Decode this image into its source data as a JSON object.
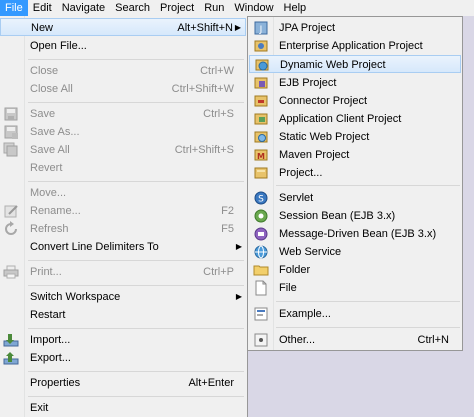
{
  "menubar": {
    "items": [
      "File",
      "Edit",
      "Navigate",
      "Search",
      "Project",
      "Run",
      "Window",
      "Help"
    ]
  },
  "file_menu": {
    "new": {
      "label": "New",
      "shortcut": "Alt+Shift+N"
    },
    "open_file": {
      "label": "Open File..."
    },
    "close": {
      "label": "Close",
      "shortcut": "Ctrl+W"
    },
    "close_all": {
      "label": "Close All",
      "shortcut": "Ctrl+Shift+W"
    },
    "save": {
      "label": "Save",
      "shortcut": "Ctrl+S"
    },
    "save_as": {
      "label": "Save As..."
    },
    "save_all": {
      "label": "Save All",
      "shortcut": "Ctrl+Shift+S"
    },
    "revert": {
      "label": "Revert"
    },
    "move": {
      "label": "Move..."
    },
    "rename": {
      "label": "Rename...",
      "shortcut": "F2"
    },
    "refresh": {
      "label": "Refresh",
      "shortcut": "F5"
    },
    "convert": {
      "label": "Convert Line Delimiters To"
    },
    "print": {
      "label": "Print...",
      "shortcut": "Ctrl+P"
    },
    "switch_workspace": {
      "label": "Switch Workspace"
    },
    "restart": {
      "label": "Restart"
    },
    "import": {
      "label": "Import..."
    },
    "export": {
      "label": "Export..."
    },
    "properties": {
      "label": "Properties",
      "shortcut": "Alt+Enter"
    },
    "exit": {
      "label": "Exit"
    }
  },
  "new_submenu": {
    "jpa_project": "JPA Project",
    "enterprise_app_project": "Enterprise Application Project",
    "dynamic_web_project": "Dynamic Web Project",
    "ejb_project": "EJB Project",
    "connector_project": "Connector Project",
    "app_client_project": "Application Client Project",
    "static_web_project": "Static Web Project",
    "maven_project": "Maven Project",
    "project": "Project...",
    "servlet": "Servlet",
    "session_bean": "Session Bean (EJB 3.x)",
    "mdb": "Message-Driven Bean (EJB 3.x)",
    "web_service": "Web Service",
    "folder": "Folder",
    "file": "File",
    "example": "Example...",
    "other": {
      "label": "Other...",
      "shortcut": "Ctrl+N"
    }
  },
  "colors": {
    "menu_bg": "#f0f0f0",
    "highlight": "#3399ff",
    "disabled_text": "#8d8d8d",
    "workspace_bg": "#d9d7e6"
  }
}
